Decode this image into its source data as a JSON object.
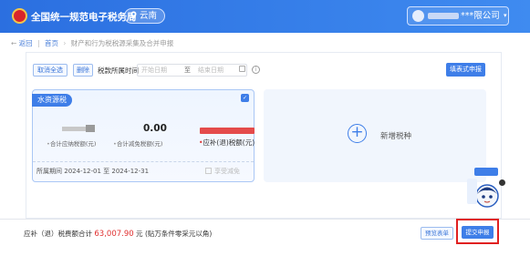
{
  "header": {
    "app_title": "全国统一规范电子税务局",
    "region": "云南",
    "company_suffix": "***限公司",
    "company_dropdown": "▾",
    "logo_icon": "tax-emblem-icon",
    "colors": {
      "brand": "#2b6fe0",
      "accent": "#3e7ee8",
      "danger": "#e03030"
    }
  },
  "breadcrumb": {
    "back": "返回",
    "home": "首页",
    "sep": "›",
    "current": "财产和行为税税源采集及合并申报"
  },
  "toolbar": {
    "cancel_select_all": "取消全选",
    "delete": "删除",
    "tax_period_label": "税款所属时间",
    "start_placeholder": "开始日期",
    "range_sep": "至",
    "end_placeholder": "结束日期",
    "info": "i",
    "guided_filing": "填表式申报"
  },
  "card": {
    "tax_name": "水资源税",
    "checkbox_mark": "✓",
    "reduction_amount": "0.00",
    "tax_payable_label": "合计应纳税额(元)",
    "tax_reduction_label": "合计减免税额(元)",
    "refund_label": "应补(退)税额(元)",
    "bullet": "•",
    "period_label": "所属期间",
    "period_start": "2024-12-01",
    "period_sep": "至",
    "period_end": "2024-12-31",
    "reduction_check": "享受减免"
  },
  "add_tax": {
    "plus": "+",
    "label": "新增税种"
  },
  "footer": {
    "total_label": "应补（退）税费额合计",
    "total_amount": "63,007.90",
    "total_unit": "元",
    "total_note": "(贴万条件零采元以角)",
    "view_report": "预览表单",
    "submit": "提交申报"
  }
}
